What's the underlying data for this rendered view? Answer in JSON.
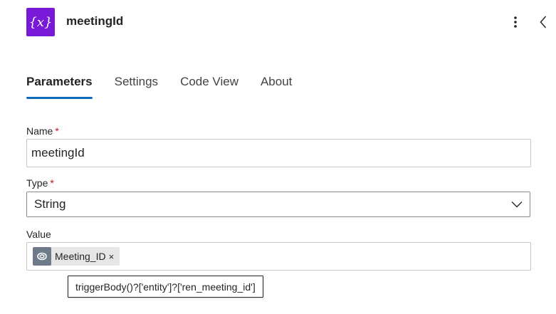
{
  "header": {
    "icon_glyph": "{x}",
    "icon_name": "variable-icon",
    "icon_color": "#7719d6",
    "title": "meetingId"
  },
  "tabs": [
    {
      "label": "Parameters",
      "active": true
    },
    {
      "label": "Settings",
      "active": false
    },
    {
      "label": "Code View",
      "active": false
    },
    {
      "label": "About",
      "active": false
    }
  ],
  "form": {
    "name": {
      "label": "Name",
      "required_marker": "*",
      "value": "meetingId"
    },
    "type": {
      "label": "Type",
      "required_marker": "*",
      "value": "String"
    },
    "value": {
      "label": "Value",
      "token": {
        "icon_name": "dataverse-icon",
        "label": "Meeting_ID",
        "remove_glyph": "×"
      }
    }
  },
  "tooltip": {
    "text": "triggerBody()?['entity']?['ren_meeting_id']"
  },
  "colors": {
    "accent": "#0f6cbd",
    "required": "#c50f1f",
    "token_bg": "#e6e6e6"
  }
}
